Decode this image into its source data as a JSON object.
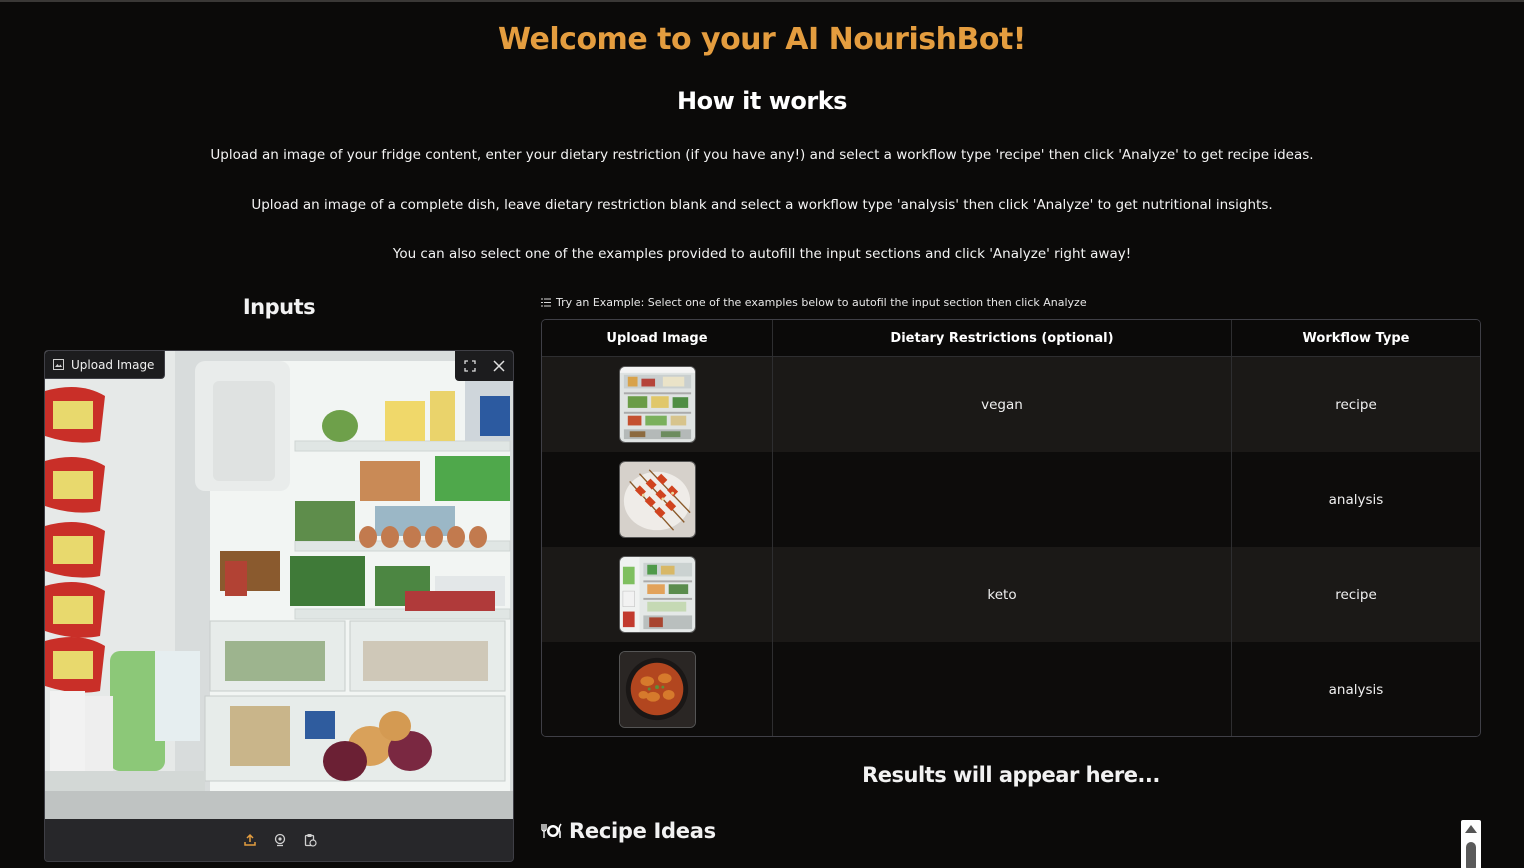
{
  "header": {
    "title": "Welcome to your AI NourishBot!",
    "subtitle": "How it works",
    "paragraphs": [
      "Upload an image of your fridge content, enter your dietary restriction (if you have any!) and select a workflow type 'recipe' then click 'Analyze' to get recipe ideas.",
      "Upload an image of a complete dish, leave dietary restriction blank and select a workflow type 'analysis' then click 'Analyze' to get nutritional insights.",
      "You can also select one of the examples provided to autofill the input sections and click 'Analyze' right away!"
    ]
  },
  "inputs": {
    "title": "Inputs",
    "upload_label": "Upload Image",
    "upload_icon": "image-icon",
    "actions": [
      "fullscreen-icon",
      "close-icon"
    ],
    "toolbar_icons": [
      "upload-icon",
      "webcam-icon",
      "clipboard-icon"
    ],
    "accent": "#e49d3f"
  },
  "examples": {
    "header": "Try an Example: Select one of the examples below to autofil the input section then click Analyze",
    "header_icon": "list-icon",
    "columns": [
      "Upload Image",
      "Dietary Restrictions (optional)",
      "Workflow Type"
    ],
    "rows": [
      {
        "image": "fridge-thumbnail",
        "dietary": "vegan",
        "workflow": "recipe"
      },
      {
        "image": "skewers-dish-thumbnail",
        "dietary": "",
        "workflow": "analysis"
      },
      {
        "image": "fridge-thumbnail-2",
        "dietary": "keto",
        "workflow": "recipe"
      },
      {
        "image": "pan-dish-thumbnail",
        "dietary": "",
        "workflow": "analysis"
      }
    ]
  },
  "results": {
    "title": "Results will appear here...",
    "recipe_title": "Recipe Ideas",
    "recipe_icon": "plate-utensils-icon"
  }
}
